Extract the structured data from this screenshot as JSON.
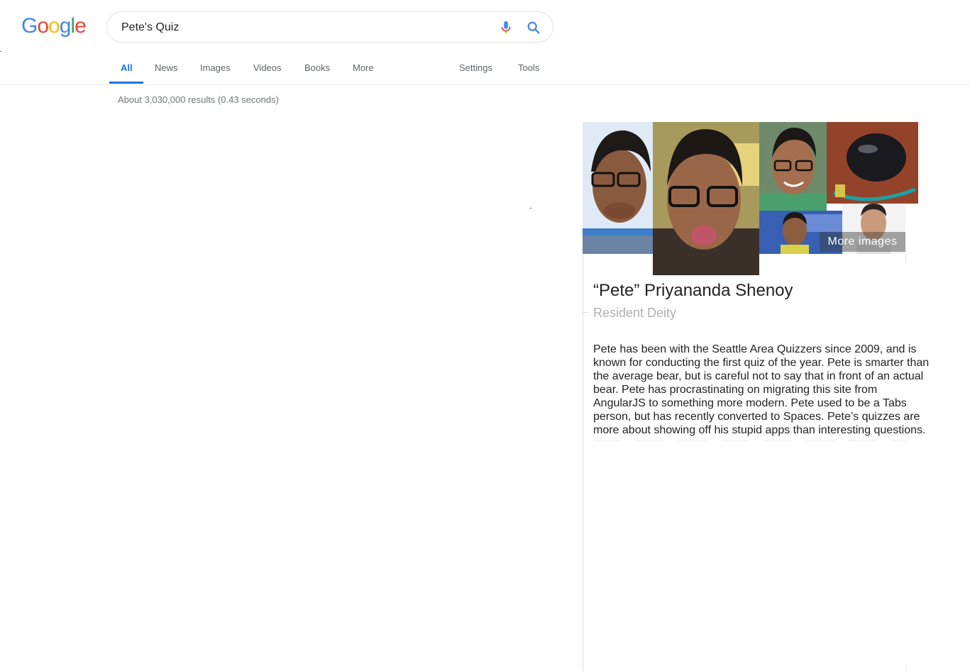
{
  "logo": {
    "letters": [
      "G",
      "o",
      "o",
      "g",
      "l",
      "e"
    ],
    "colors": [
      "#4285F4",
      "#EA4335",
      "#FBBC05",
      "#4285F4",
      "#34A853",
      "#EA4335"
    ]
  },
  "search": {
    "query": "Pete's Quiz"
  },
  "tabs": [
    {
      "label": "All",
      "active": true
    },
    {
      "label": "News"
    },
    {
      "label": "Images"
    },
    {
      "label": "Videos"
    },
    {
      "label": "Books"
    },
    {
      "label": "More"
    }
  ],
  "tools": [
    {
      "label": "Settings"
    },
    {
      "label": "Tools"
    }
  ],
  "results_stats": "About 3,030,000 results (0.43 seconds)",
  "knowledge_panel": {
    "more_images_label": "More images",
    "title": "“Pete” Priyananda Shenoy",
    "subtitle": "Resident Deity",
    "description": "Pete has been with the Seattle Area Quizzers since 2009, and is known for conducting the first quiz of the year. Pete is smarter than the average bear, but is careful not to say that in front of an actual bear. Pete has procrastinating on migrating this site from AngularJS to something more modern. Pete used to be a Tabs person, but has recently converted to Spaces. Pete’s quizzes are more about showing off his stupid apps than interesting questions."
  },
  "colors": {
    "accent": "#1a73e8",
    "muted": "#5f6368"
  }
}
